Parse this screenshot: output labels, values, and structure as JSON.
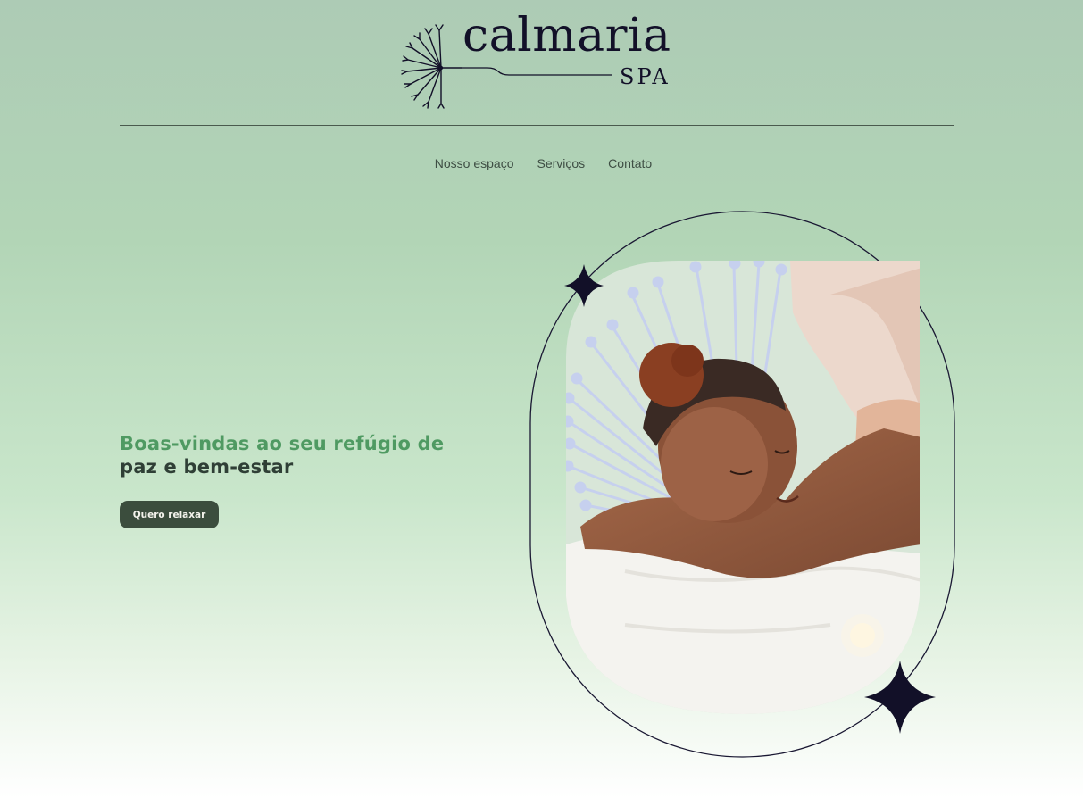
{
  "brand": {
    "name": "calmaria",
    "subtitle": "SPA",
    "logo_icon": "dandelion-icon"
  },
  "nav": {
    "items": [
      {
        "label": "Nosso espaço"
      },
      {
        "label": "Serviços"
      },
      {
        "label": "Contato"
      }
    ]
  },
  "hero": {
    "title_line1": "Boas-vindas ao seu refúgio de",
    "title_line2": "paz e bem-estar",
    "cta_label": "Quero relaxar",
    "image_subject": "woman-receiving-back-massage",
    "decor_icons": [
      "sparkle-star-icon",
      "dandelion-icon"
    ]
  },
  "colors": {
    "accent_green": "#4f9a62",
    "dark_green": "#3b4d3d",
    "navy": "#121028",
    "lavender": "#c6d0ee"
  }
}
